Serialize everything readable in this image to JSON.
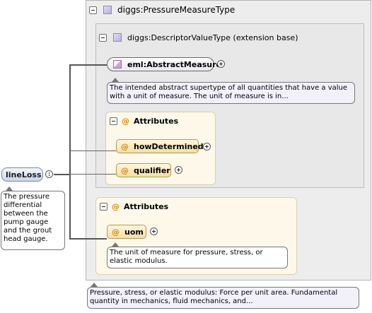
{
  "root_type": {
    "name": "diggs:PressureMeasureType",
    "doc": "Pressure, stress, or elastic modulus: Force per unit area. Fundamental quantity in mechanics, fluid mechanics, and..."
  },
  "base_type": {
    "name": "diggs:DescriptorValueType (extension base)"
  },
  "abstract_measure": {
    "name": "eml:AbstractMeasure",
    "doc": "The intended abstract supertype of all quantities that have a value with a unit of measure. The unit of measure is in..."
  },
  "base_attributes": {
    "header": "Attributes",
    "at_symbol": "@",
    "items": [
      {
        "name": "howDetermined"
      },
      {
        "name": "qualifier"
      }
    ]
  },
  "own_attributes": {
    "header": "Attributes",
    "at_symbol": "@",
    "items": [
      {
        "name": "uom",
        "doc": "The unit of measure for pressure, stress, or elastic modulus."
      }
    ]
  },
  "element": {
    "name": "lineLoss",
    "doc": "The pressure differential between the pump gauge and the grout head gauge."
  },
  "icons": {
    "type": "complex-type-icon",
    "abstract": "abstract-element-icon",
    "collapse": "minus-toggle-icon",
    "expand": "plus-circle-icon"
  }
}
